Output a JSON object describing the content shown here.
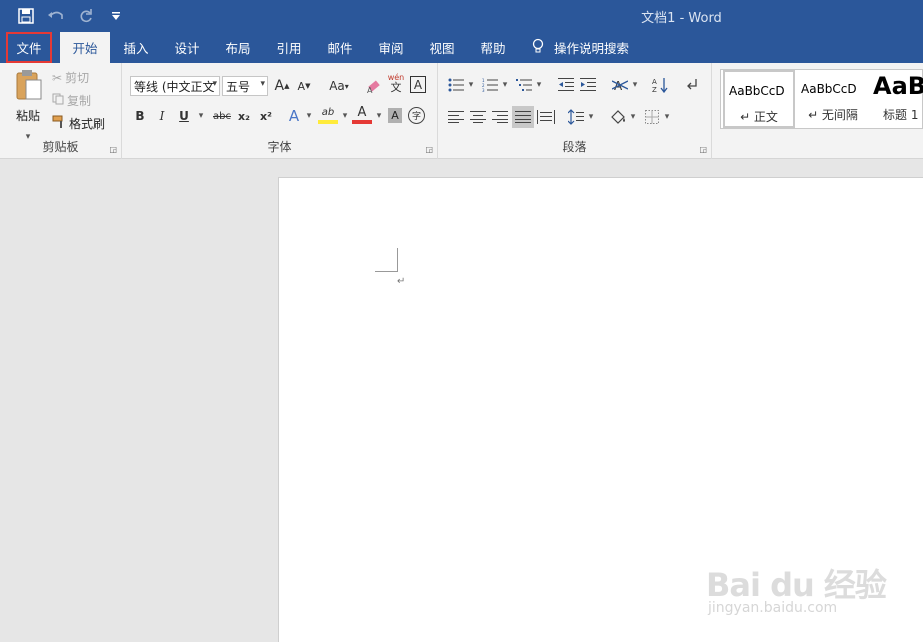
{
  "titlebar": {
    "doc_title": "文档1  -  Word",
    "qat": [
      "save-icon",
      "undo-icon",
      "redo-icon",
      "customize-qat-icon"
    ]
  },
  "tabs": {
    "file": "文件",
    "home": "开始",
    "insert": "插入",
    "design": "设计",
    "layout": "布局",
    "references": "引用",
    "mailings": "邮件",
    "review": "审阅",
    "view": "视图",
    "help": "帮助",
    "tell_me": "操作说明搜索"
  },
  "clipboard": {
    "paste": "粘贴",
    "cut": "剪切",
    "copy": "复制",
    "format_painter": "格式刷",
    "label": "剪贴板"
  },
  "font": {
    "font_name": "等线 (中文正文",
    "font_size": "五号",
    "grow": "A",
    "shrink": "A",
    "change_case": "Aa",
    "phonetic_top": "wén",
    "phonetic_bottom": "文",
    "border_char": "A",
    "bold": "B",
    "italic": "I",
    "underline": "U",
    "strike": "abc",
    "subscript": "x₂",
    "superscript": "x²",
    "text_effects": "A",
    "highlight": "ab",
    "font_color": "A",
    "char_shading": "A",
    "enclosed": "字",
    "label": "字体",
    "accent_red": "#e53935",
    "accent_yellow": "#ffeb3b"
  },
  "paragraph": {
    "label": "段落"
  },
  "styles": {
    "items": [
      {
        "sample": "AaBbCcD​",
        "name": "↵ 正文"
      },
      {
        "sample": "AaBbCcD​",
        "name": "↵ 无间隔"
      },
      {
        "sample": "AaB",
        "name": "标题 1"
      }
    ]
  },
  "document": {
    "paragraph_mark": "↵"
  },
  "watermark": {
    "logo": "Bai du 经验",
    "url": "jingyan.baidu.com"
  }
}
